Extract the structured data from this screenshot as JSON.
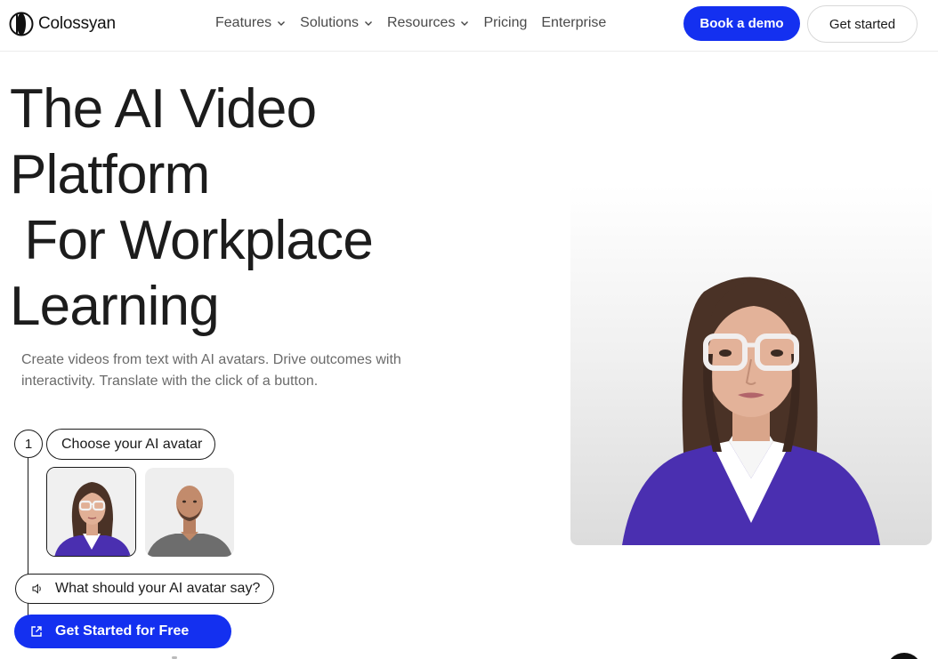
{
  "nav": {
    "logo_text": "Colossyan",
    "items": [
      {
        "label": "Features",
        "has_dropdown": true
      },
      {
        "label": "Solutions",
        "has_dropdown": true
      },
      {
        "label": "Resources",
        "has_dropdown": true
      },
      {
        "label": "Pricing",
        "has_dropdown": false
      },
      {
        "label": "Enterprise",
        "has_dropdown": false
      }
    ],
    "book_demo_label": "Book a demo",
    "get_started_label": "Get started"
  },
  "hero": {
    "title_lines": [
      "The AI Video",
      "Platform",
      " For Workplace",
      "Learning"
    ],
    "subtitle": "Create videos from text with AI avatars. Drive outcomes with interactivity. Translate with the click of a button."
  },
  "steps": {
    "step_number": "1",
    "choose_avatar_label": "Choose your AI avatar",
    "avatars": [
      {
        "name": "female-avatar",
        "selected": true
      },
      {
        "name": "male-avatar",
        "selected": false
      }
    ],
    "say_label": "What should your AI avatar say?",
    "cta_label": "Get Started for Free"
  },
  "colors": {
    "accent": "#1430f0",
    "text": "#1c1c1c",
    "muted": "#6b6b6b",
    "sweater": "#4a2fb0"
  },
  "icons": {
    "logo": "colossyan-logo-icon",
    "dropdown": "chevron-down-icon",
    "speaker": "speaker-icon",
    "external": "external-link-icon"
  }
}
